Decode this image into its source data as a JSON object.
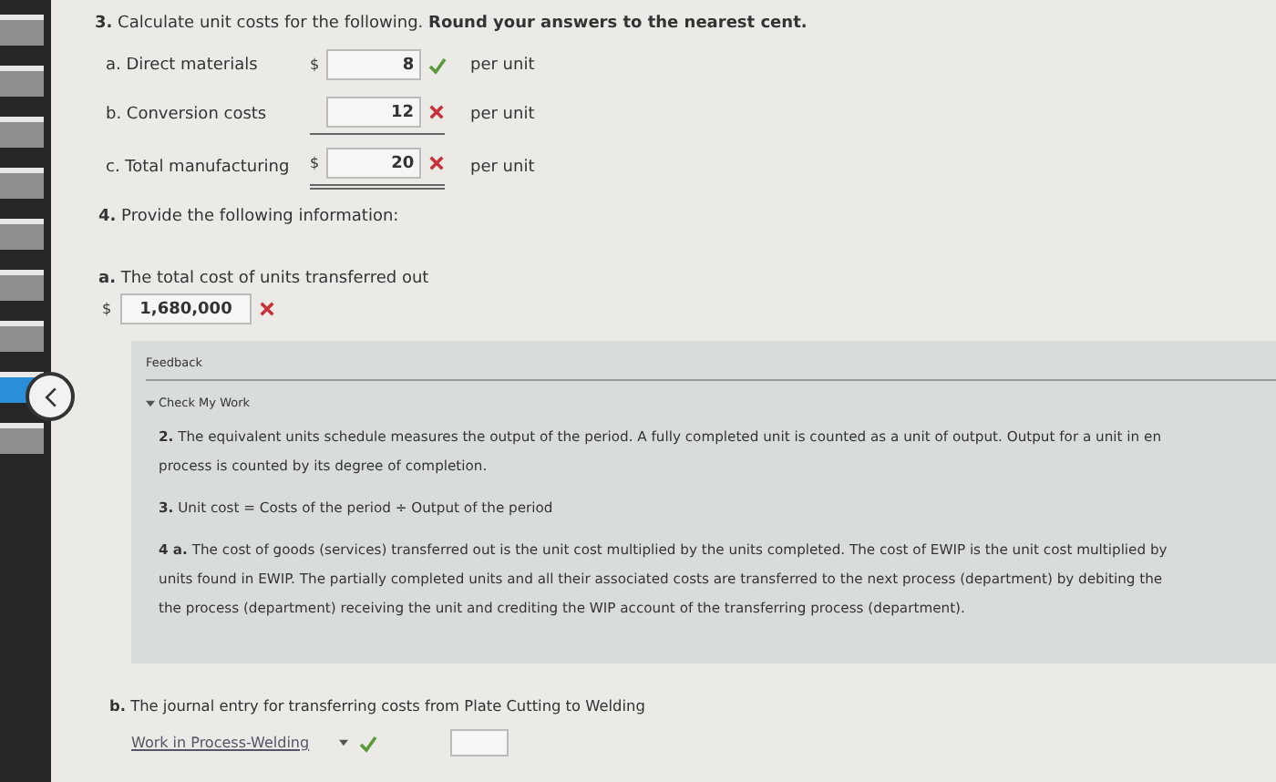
{
  "sidebar": {
    "tabs": [
      {
        "selected": false
      },
      {
        "selected": false
      },
      {
        "selected": false
      },
      {
        "selected": false
      },
      {
        "selected": false
      },
      {
        "selected": false
      },
      {
        "selected": false
      },
      {
        "selected": true
      },
      {
        "selected": false
      }
    ]
  },
  "question3": {
    "prompt": "**3.** Calculate unit costs for the following. **Round your answers to the nearest cent.**",
    "rows": [
      {
        "label": "a. Direct materials",
        "currency": "$",
        "value": "8",
        "correct": true,
        "unit": "per unit",
        "underlined": false,
        "double_underlined": false
      },
      {
        "label": "b. Conversion costs",
        "value": "12",
        "correct": false,
        "unit": "per unit",
        "underlined": true,
        "double_underlined": false
      },
      {
        "label": "c. Total manufacturing",
        "currency": "$",
        "value": "20",
        "correct": false,
        "unit": "per unit",
        "underlined": false,
        "double_underlined": true
      }
    ]
  },
  "question4": {
    "prompt": "**4.** Provide the following information:",
    "part_a": {
      "label": "**a.** The total cost of units transferred out",
      "currency": "$",
      "value": "1,680,000",
      "correct": false
    }
  },
  "feedback": {
    "title": "Feedback",
    "toggle": {
      "label": "Check My Work",
      "expanded": true
    },
    "paragraphs": [
      [
        "**2.** The equivalent units schedule measures the output of the period. A fully completed unit is counted as a unit of output. Output for a unit in en",
        "process is counted by its degree of completion."
      ],
      [
        "**3.** Unit cost = Costs of the period ÷ Output of the period"
      ],
      [
        "**4 a.** The cost of goods (services) transferred out is the unit cost multiplied by the units completed. The cost of EWIP is the unit cost multiplied by",
        "units found in EWIP. The partially completed units and all their associated costs are transferred to the next process (department) by debiting the",
        "the process (department) receiving the unit and crediting the WIP account of the transferring process (department)."
      ]
    ]
  },
  "part_b": {
    "label": "**b.** The journal entry for transferring costs from Plate Cutting to Welding",
    "account": {
      "value": "Work in Process-Welding",
      "correct": true
    }
  }
}
